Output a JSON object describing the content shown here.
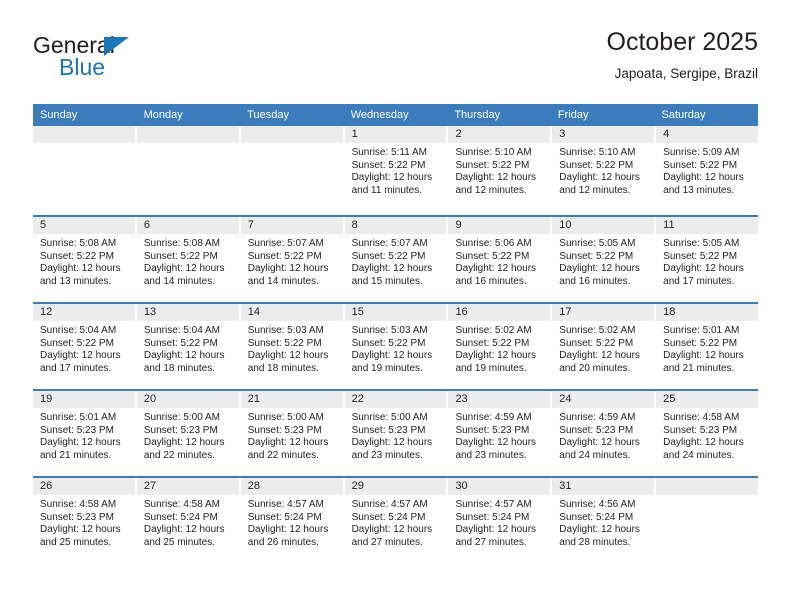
{
  "brand": {
    "name_top": "General",
    "name_bottom": "Blue",
    "triangle_color": "#1b75bb"
  },
  "header": {
    "title": "October 2025",
    "subtitle": "Japoata, Sergipe, Brazil"
  },
  "theme": {
    "header_blue": "#3a7cbe",
    "date_band": "#ececec",
    "text": "#231f20"
  },
  "weekdays": [
    "Sunday",
    "Monday",
    "Tuesday",
    "Wednesday",
    "Thursday",
    "Friday",
    "Saturday"
  ],
  "weeks": [
    [
      {
        "date": "",
        "sunrise": "",
        "sunset": "",
        "daylight_line1": "",
        "daylight_line2": ""
      },
      {
        "date": "",
        "sunrise": "",
        "sunset": "",
        "daylight_line1": "",
        "daylight_line2": ""
      },
      {
        "date": "",
        "sunrise": "",
        "sunset": "",
        "daylight_line1": "",
        "daylight_line2": ""
      },
      {
        "date": "1",
        "sunrise": "Sunrise: 5:11 AM",
        "sunset": "Sunset: 5:22 PM",
        "daylight_line1": "Daylight: 12 hours",
        "daylight_line2": "and 11 minutes."
      },
      {
        "date": "2",
        "sunrise": "Sunrise: 5:10 AM",
        "sunset": "Sunset: 5:22 PM",
        "daylight_line1": "Daylight: 12 hours",
        "daylight_line2": "and 12 minutes."
      },
      {
        "date": "3",
        "sunrise": "Sunrise: 5:10 AM",
        "sunset": "Sunset: 5:22 PM",
        "daylight_line1": "Daylight: 12 hours",
        "daylight_line2": "and 12 minutes."
      },
      {
        "date": "4",
        "sunrise": "Sunrise: 5:09 AM",
        "sunset": "Sunset: 5:22 PM",
        "daylight_line1": "Daylight: 12 hours",
        "daylight_line2": "and 13 minutes."
      }
    ],
    [
      {
        "date": "5",
        "sunrise": "Sunrise: 5:08 AM",
        "sunset": "Sunset: 5:22 PM",
        "daylight_line1": "Daylight: 12 hours",
        "daylight_line2": "and 13 minutes."
      },
      {
        "date": "6",
        "sunrise": "Sunrise: 5:08 AM",
        "sunset": "Sunset: 5:22 PM",
        "daylight_line1": "Daylight: 12 hours",
        "daylight_line2": "and 14 minutes."
      },
      {
        "date": "7",
        "sunrise": "Sunrise: 5:07 AM",
        "sunset": "Sunset: 5:22 PM",
        "daylight_line1": "Daylight: 12 hours",
        "daylight_line2": "and 14 minutes."
      },
      {
        "date": "8",
        "sunrise": "Sunrise: 5:07 AM",
        "sunset": "Sunset: 5:22 PM",
        "daylight_line1": "Daylight: 12 hours",
        "daylight_line2": "and 15 minutes."
      },
      {
        "date": "9",
        "sunrise": "Sunrise: 5:06 AM",
        "sunset": "Sunset: 5:22 PM",
        "daylight_line1": "Daylight: 12 hours",
        "daylight_line2": "and 16 minutes."
      },
      {
        "date": "10",
        "sunrise": "Sunrise: 5:05 AM",
        "sunset": "Sunset: 5:22 PM",
        "daylight_line1": "Daylight: 12 hours",
        "daylight_line2": "and 16 minutes."
      },
      {
        "date": "11",
        "sunrise": "Sunrise: 5:05 AM",
        "sunset": "Sunset: 5:22 PM",
        "daylight_line1": "Daylight: 12 hours",
        "daylight_line2": "and 17 minutes."
      }
    ],
    [
      {
        "date": "12",
        "sunrise": "Sunrise: 5:04 AM",
        "sunset": "Sunset: 5:22 PM",
        "daylight_line1": "Daylight: 12 hours",
        "daylight_line2": "and 17 minutes."
      },
      {
        "date": "13",
        "sunrise": "Sunrise: 5:04 AM",
        "sunset": "Sunset: 5:22 PM",
        "daylight_line1": "Daylight: 12 hours",
        "daylight_line2": "and 18 minutes."
      },
      {
        "date": "14",
        "sunrise": "Sunrise: 5:03 AM",
        "sunset": "Sunset: 5:22 PM",
        "daylight_line1": "Daylight: 12 hours",
        "daylight_line2": "and 18 minutes."
      },
      {
        "date": "15",
        "sunrise": "Sunrise: 5:03 AM",
        "sunset": "Sunset: 5:22 PM",
        "daylight_line1": "Daylight: 12 hours",
        "daylight_line2": "and 19 minutes."
      },
      {
        "date": "16",
        "sunrise": "Sunrise: 5:02 AM",
        "sunset": "Sunset: 5:22 PM",
        "daylight_line1": "Daylight: 12 hours",
        "daylight_line2": "and 19 minutes."
      },
      {
        "date": "17",
        "sunrise": "Sunrise: 5:02 AM",
        "sunset": "Sunset: 5:22 PM",
        "daylight_line1": "Daylight: 12 hours",
        "daylight_line2": "and 20 minutes."
      },
      {
        "date": "18",
        "sunrise": "Sunrise: 5:01 AM",
        "sunset": "Sunset: 5:22 PM",
        "daylight_line1": "Daylight: 12 hours",
        "daylight_line2": "and 21 minutes."
      }
    ],
    [
      {
        "date": "19",
        "sunrise": "Sunrise: 5:01 AM",
        "sunset": "Sunset: 5:23 PM",
        "daylight_line1": "Daylight: 12 hours",
        "daylight_line2": "and 21 minutes."
      },
      {
        "date": "20",
        "sunrise": "Sunrise: 5:00 AM",
        "sunset": "Sunset: 5:23 PM",
        "daylight_line1": "Daylight: 12 hours",
        "daylight_line2": "and 22 minutes."
      },
      {
        "date": "21",
        "sunrise": "Sunrise: 5:00 AM",
        "sunset": "Sunset: 5:23 PM",
        "daylight_line1": "Daylight: 12 hours",
        "daylight_line2": "and 22 minutes."
      },
      {
        "date": "22",
        "sunrise": "Sunrise: 5:00 AM",
        "sunset": "Sunset: 5:23 PM",
        "daylight_line1": "Daylight: 12 hours",
        "daylight_line2": "and 23 minutes."
      },
      {
        "date": "23",
        "sunrise": "Sunrise: 4:59 AM",
        "sunset": "Sunset: 5:23 PM",
        "daylight_line1": "Daylight: 12 hours",
        "daylight_line2": "and 23 minutes."
      },
      {
        "date": "24",
        "sunrise": "Sunrise: 4:59 AM",
        "sunset": "Sunset: 5:23 PM",
        "daylight_line1": "Daylight: 12 hours",
        "daylight_line2": "and 24 minutes."
      },
      {
        "date": "25",
        "sunrise": "Sunrise: 4:58 AM",
        "sunset": "Sunset: 5:23 PM",
        "daylight_line1": "Daylight: 12 hours",
        "daylight_line2": "and 24 minutes."
      }
    ],
    [
      {
        "date": "26",
        "sunrise": "Sunrise: 4:58 AM",
        "sunset": "Sunset: 5:23 PM",
        "daylight_line1": "Daylight: 12 hours",
        "daylight_line2": "and 25 minutes."
      },
      {
        "date": "27",
        "sunrise": "Sunrise: 4:58 AM",
        "sunset": "Sunset: 5:24 PM",
        "daylight_line1": "Daylight: 12 hours",
        "daylight_line2": "and 25 minutes."
      },
      {
        "date": "28",
        "sunrise": "Sunrise: 4:57 AM",
        "sunset": "Sunset: 5:24 PM",
        "daylight_line1": "Daylight: 12 hours",
        "daylight_line2": "and 26 minutes."
      },
      {
        "date": "29",
        "sunrise": "Sunrise: 4:57 AM",
        "sunset": "Sunset: 5:24 PM",
        "daylight_line1": "Daylight: 12 hours",
        "daylight_line2": "and 27 minutes."
      },
      {
        "date": "30",
        "sunrise": "Sunrise: 4:57 AM",
        "sunset": "Sunset: 5:24 PM",
        "daylight_line1": "Daylight: 12 hours",
        "daylight_line2": "and 27 minutes."
      },
      {
        "date": "31",
        "sunrise": "Sunrise: 4:56 AM",
        "sunset": "Sunset: 5:24 PM",
        "daylight_line1": "Daylight: 12 hours",
        "daylight_line2": "and 28 minutes."
      },
      {
        "date": "",
        "sunrise": "",
        "sunset": "",
        "daylight_line1": "",
        "daylight_line2": ""
      }
    ]
  ]
}
